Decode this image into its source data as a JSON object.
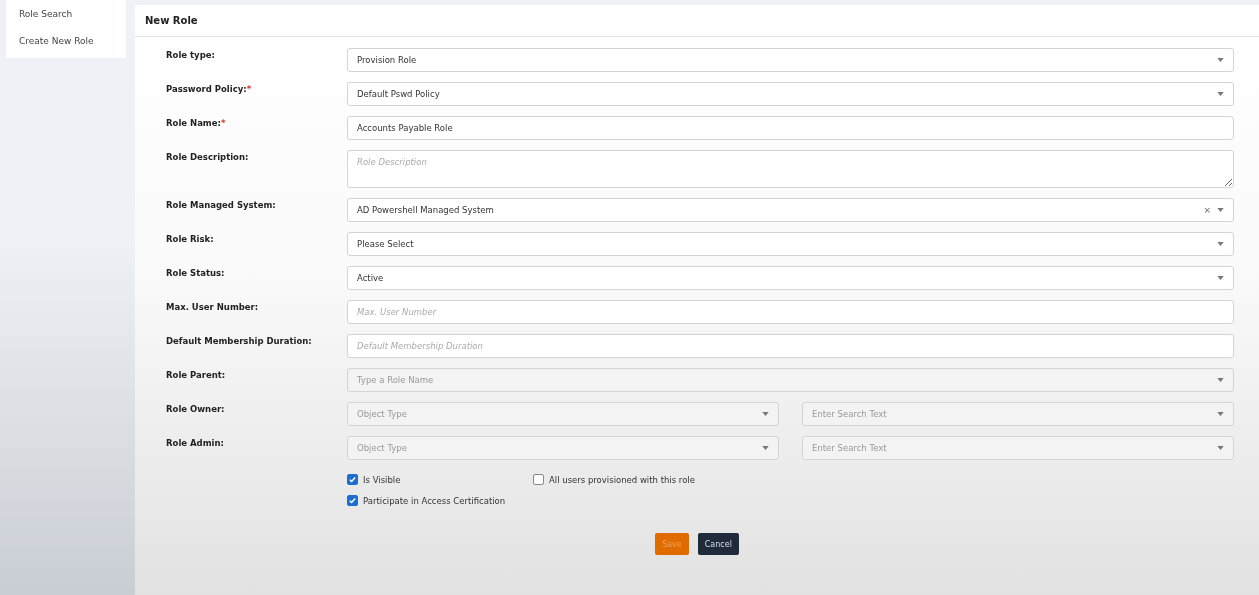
{
  "sidebar": {
    "items": [
      {
        "label": "Role Search",
        "selected": false
      },
      {
        "label": "Create New Role",
        "selected": false
      }
    ]
  },
  "panel": {
    "title": "New Role",
    "fields": [
      {
        "kind": "select",
        "label": "Role type:",
        "value": "Provision Role"
      },
      {
        "kind": "select",
        "label": "Password Policy:",
        "required_mark": "*",
        "value": "Default Pswd Policy"
      },
      {
        "kind": "text",
        "label": "Role Name:",
        "required_mark": "*",
        "value": "Accounts Payable Role"
      },
      {
        "kind": "textarea",
        "label": "Role Description:",
        "placeholder": "Role Description"
      },
      {
        "kind": "select",
        "label": "Role Managed System:",
        "value": "AD Powershell Managed System",
        "clear": "×"
      },
      {
        "kind": "select",
        "label": "Role Risk:",
        "value": "Please Select"
      },
      {
        "kind": "select",
        "label": "Role Status:",
        "value": "Active"
      },
      {
        "kind": "text",
        "label": "Max. User Number:",
        "placeholder": "Max. User Number"
      },
      {
        "kind": "text",
        "label": "Default Membership Duration:",
        "placeholder": "Default Membership Duration"
      },
      {
        "kind": "select",
        "label": "Role Parent:",
        "placeholder": "Type a Role Name",
        "disabled": true
      },
      {
        "kind": "dual",
        "label": "Role Owner:",
        "placeholder": "Object Type",
        "placeholder_2": "Enter Search Text",
        "disabled": true
      },
      {
        "kind": "dual",
        "label": "Role Admin:",
        "placeholder": "Object Type",
        "placeholder_2": "Enter Search Text",
        "disabled": true
      }
    ],
    "checkboxes": [
      {
        "label": "Is Visible",
        "checked": true
      },
      {
        "label": "All users provisioned with this role",
        "checked": false
      },
      {
        "label": "Participate in Access Certification",
        "checked": true
      }
    ],
    "buttons": [
      {
        "label": "Save",
        "kind": "primary"
      },
      {
        "label": "Cancel",
        "kind": "secondary"
      }
    ]
  }
}
